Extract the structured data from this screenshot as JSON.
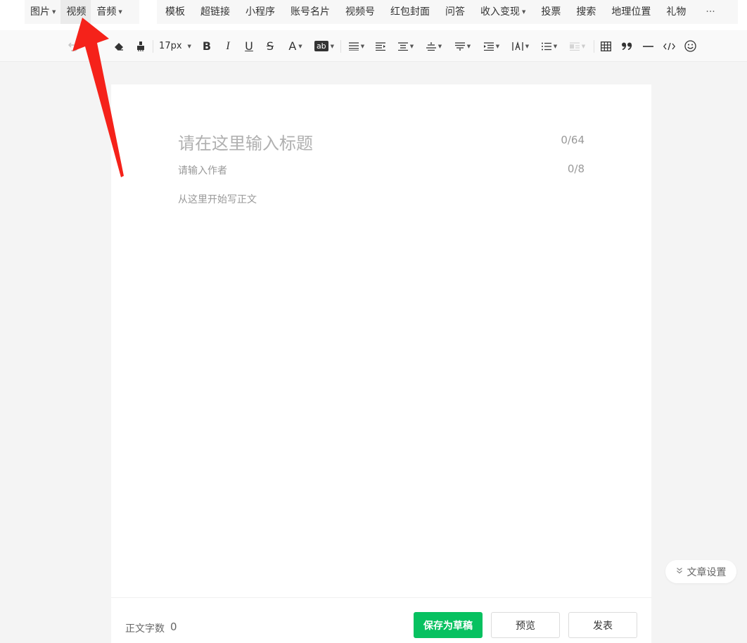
{
  "insert_menu": {
    "group1": [
      {
        "label": "图片",
        "dropdown": true
      },
      {
        "label": "视频",
        "dropdown": false
      },
      {
        "label": "音频",
        "dropdown": true
      }
    ],
    "group2": [
      {
        "label": "模板",
        "dropdown": false
      },
      {
        "label": "超链接",
        "dropdown": false
      },
      {
        "label": "小程序",
        "dropdown": false
      },
      {
        "label": "账号名片",
        "dropdown": false
      },
      {
        "label": "视频号",
        "dropdown": false
      },
      {
        "label": "红包封面",
        "dropdown": false
      },
      {
        "label": "问答",
        "dropdown": false
      },
      {
        "label": "收入变现",
        "dropdown": true
      },
      {
        "label": "投票",
        "dropdown": false
      },
      {
        "label": "搜索",
        "dropdown": false
      },
      {
        "label": "地理位置",
        "dropdown": false
      },
      {
        "label": "礼物",
        "dropdown": false
      }
    ],
    "more": "···"
  },
  "toolbar": {
    "font_size": "17px",
    "bold": "B",
    "italic": "I",
    "underline": "U",
    "strike": "S",
    "font_color": "A",
    "bg_color": "ab"
  },
  "editor": {
    "title_placeholder": "请在这里输入标题",
    "title_count": "0/64",
    "author_placeholder": "请输入作者",
    "author_count": "0/8",
    "body_placeholder": "从这里开始写正文"
  },
  "footer": {
    "word_count_label": "正文字数",
    "word_count_value": "0",
    "save_draft": "保存为草稿",
    "preview": "预览",
    "publish": "发表"
  },
  "article_settings": "文章设置",
  "colors": {
    "primary_green": "#07c160",
    "annotation_arrow": "#f5221a"
  }
}
